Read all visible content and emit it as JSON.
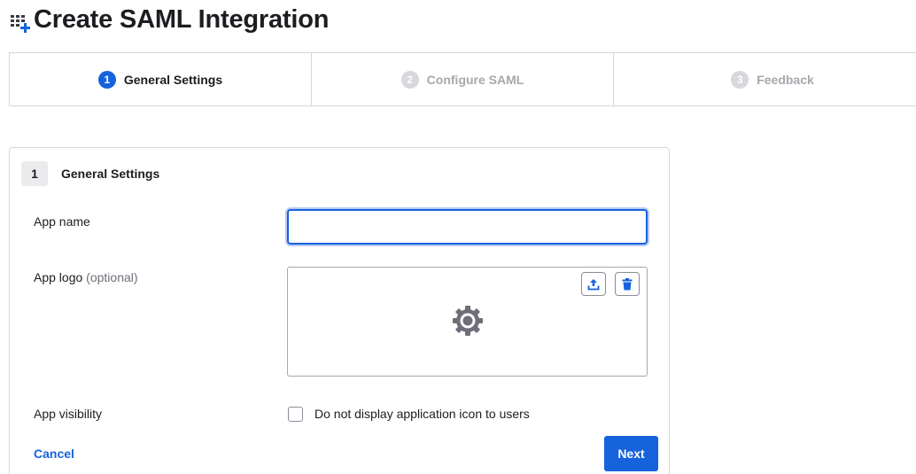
{
  "page": {
    "title": "Create SAML Integration",
    "title_icon": "app-grid-plus-icon"
  },
  "steps": [
    {
      "number": "1",
      "label": "General Settings",
      "state": "active"
    },
    {
      "number": "2",
      "label": "Configure SAML",
      "state": "inactive"
    },
    {
      "number": "3",
      "label": "Feedback",
      "state": "inactive"
    }
  ],
  "card": {
    "number": "1",
    "title": "General Settings",
    "app_name": {
      "label": "App name",
      "value": "",
      "placeholder": ""
    },
    "app_logo": {
      "label": "App logo",
      "optional": "(optional)",
      "upload_icon": "upload-icon",
      "delete_icon": "trash-icon",
      "placeholder_icon": "gear-icon"
    },
    "app_visibility": {
      "label": "App visibility",
      "checkbox_label": "Do not display application icon to users",
      "checked": false
    },
    "cancel_label": "Cancel",
    "next_label": "Next"
  },
  "colors": {
    "accent": "#1662dd",
    "border": "#d7d7dc",
    "muted": "#a7a7ae"
  }
}
